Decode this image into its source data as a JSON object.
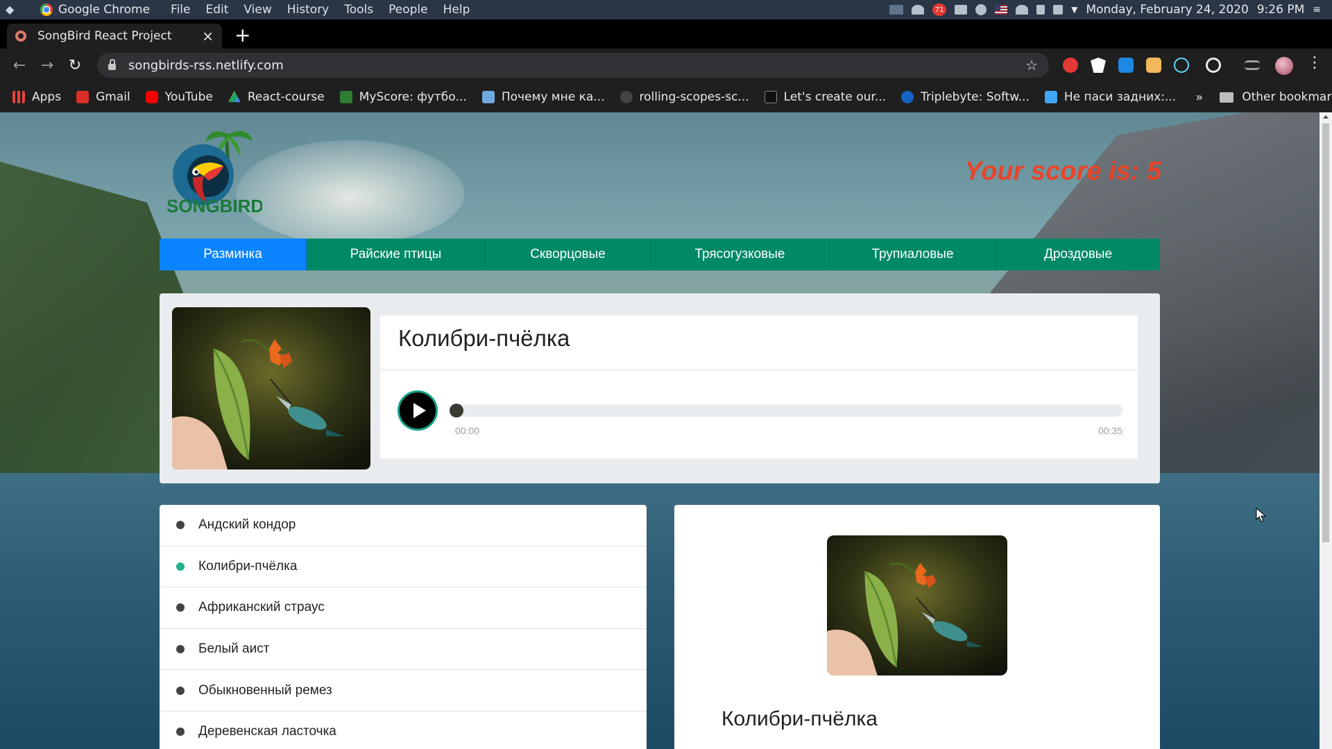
{
  "os": {
    "app_name": "Google Chrome",
    "menus": [
      "File",
      "Edit",
      "View",
      "History",
      "Tools",
      "People",
      "Help"
    ],
    "tray_badge": "71",
    "clock": "Monday, February 24, 2020",
    "time": "9:26 PM"
  },
  "browser": {
    "tab_title": "SongBird React Project",
    "tab_close": "×",
    "new_tab": "+",
    "url": "songbirds-rss.netlify.com",
    "bookmarks": [
      {
        "label": "Apps",
        "color": "#e8453c"
      },
      {
        "label": "Gmail",
        "color": "#d93025"
      },
      {
        "label": "YouTube",
        "color": "#ff0000"
      },
      {
        "label": "React-course",
        "color": "#1fa463"
      },
      {
        "label": "MyScore: футбо...",
        "color": "#2e7d32"
      },
      {
        "label": "Почему мне ка...",
        "color": "#6fa8dc"
      },
      {
        "label": "rolling-scopes-sc...",
        "color": "#444444"
      },
      {
        "label": "Let's create our...",
        "color": "#111111"
      },
      {
        "label": "Triplebyte: Softw...",
        "color": "#1565c0"
      },
      {
        "label": "Не паси задних:...",
        "color": "#42a5f5"
      }
    ],
    "more_bookmarks": "»",
    "other_bookmarks": "Other bookmarks"
  },
  "app": {
    "logo_text": "SONGBIRD",
    "score_text": "Your score is: 5",
    "categories": [
      "Разминка",
      "Райские птицы",
      "Скворцовые",
      "Трясогузковые",
      "Трупиаловые",
      "Дроздовые"
    ],
    "active_category": "Разминка",
    "question": {
      "title": "Колибри-пчёлка",
      "current_time": "00:00",
      "duration": "00:35"
    },
    "answers": [
      {
        "label": "Андский кондор",
        "correct": false
      },
      {
        "label": "Колибри-пчёлка",
        "correct": true
      },
      {
        "label": "Африканский страус",
        "correct": false
      },
      {
        "label": "Белый аист",
        "correct": false
      },
      {
        "label": "Обыкновенный ремез",
        "correct": false
      },
      {
        "label": "Деревенская ласточка",
        "correct": false
      }
    ],
    "detail": {
      "title": "Колибри-пчёлка"
    },
    "colors": {
      "nav_green": "#008966",
      "nav_active": "#0a84ff",
      "score_red": "#e8452a",
      "correct_dot": "#1fb58c"
    }
  }
}
